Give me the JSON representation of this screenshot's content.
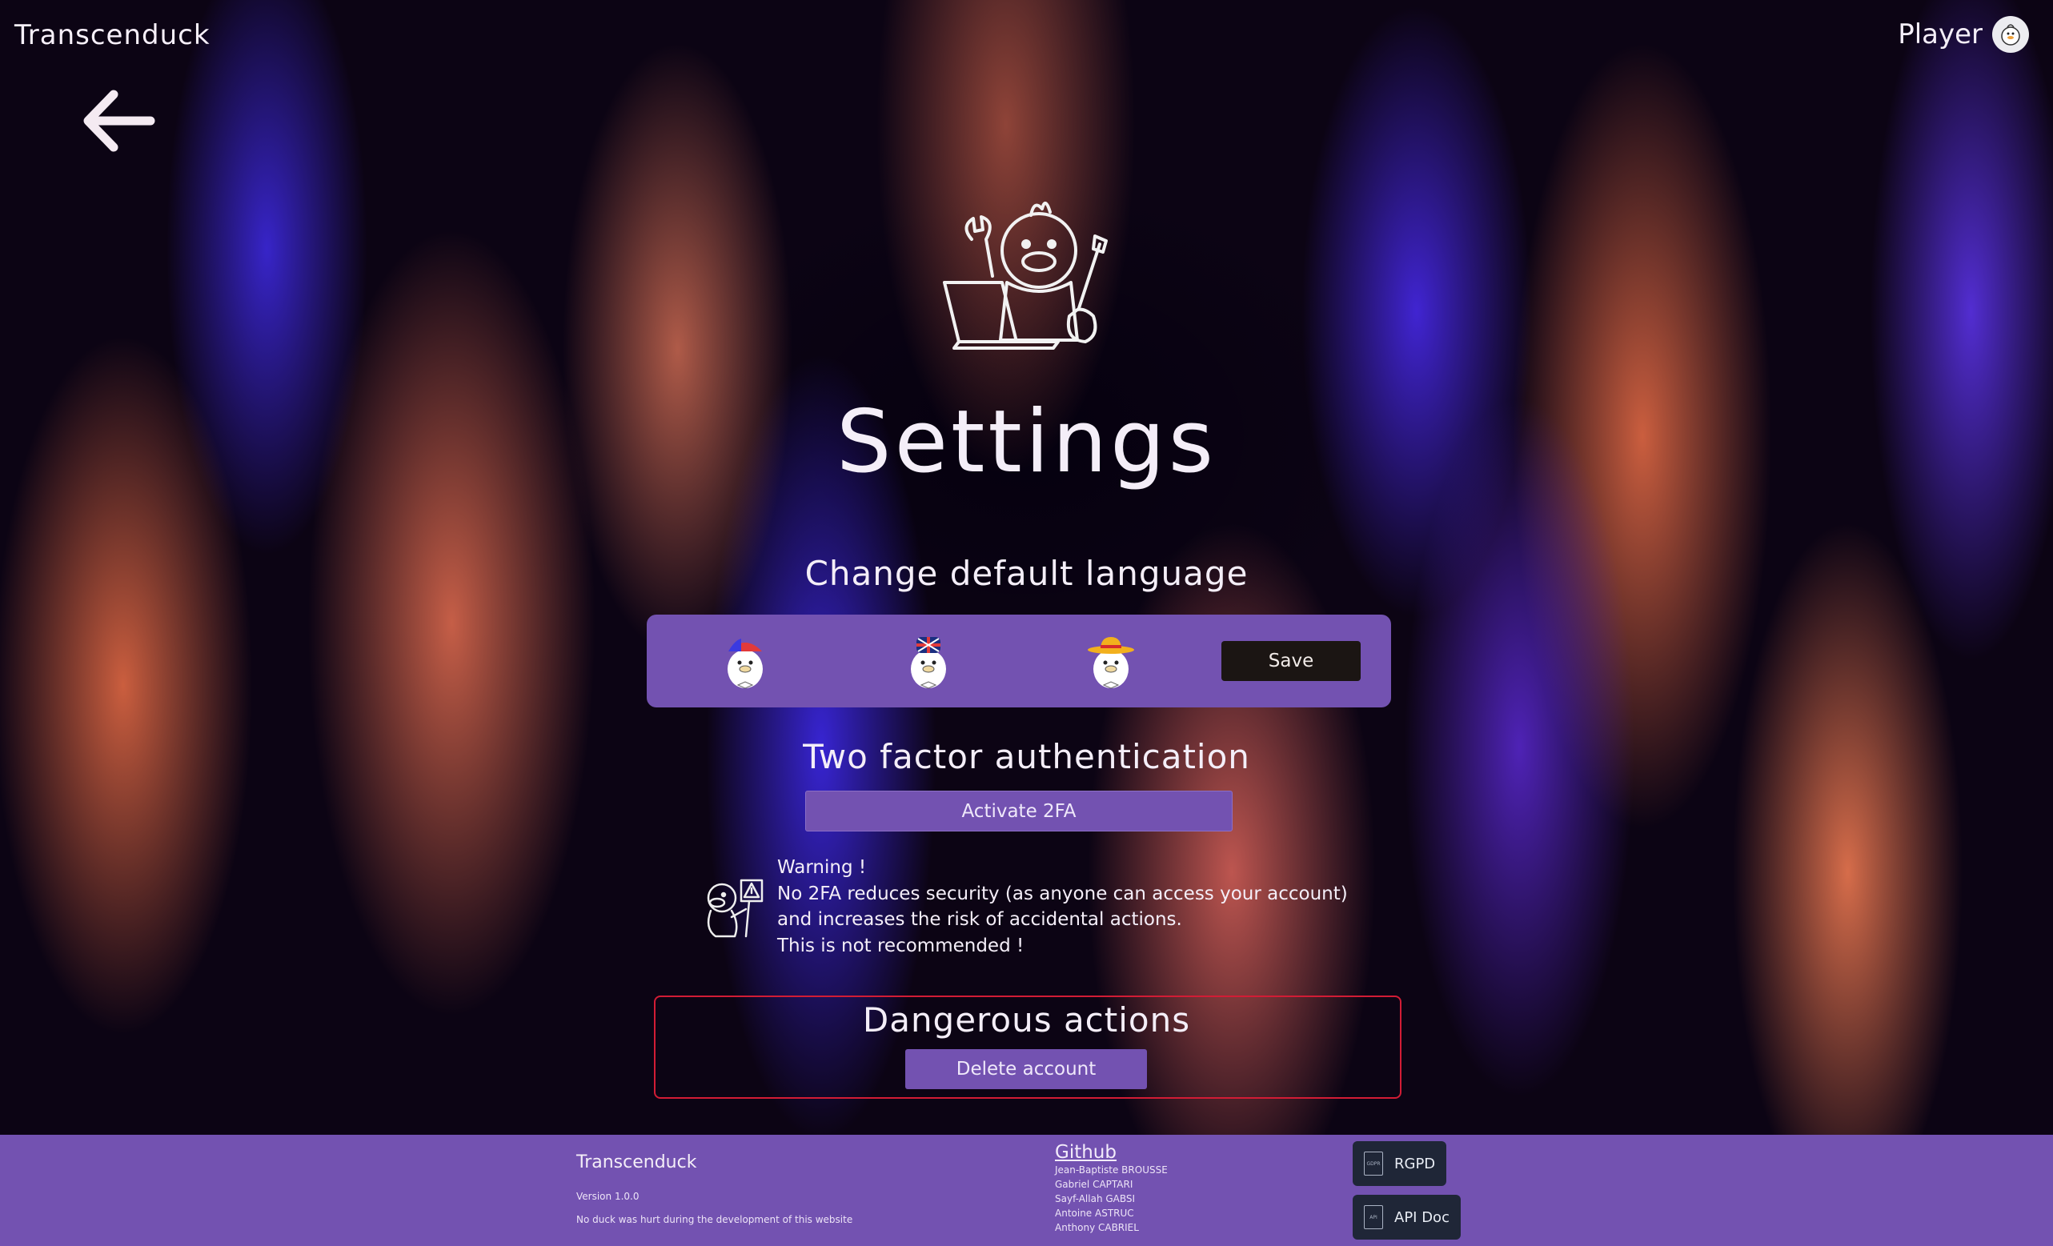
{
  "header": {
    "brand": "Transcenduck",
    "user_name": "Player",
    "back_icon": "arrow-left-icon",
    "avatar_icon": "duck-avatar-icon"
  },
  "page": {
    "title": "Settings",
    "hero_icon": "duck-repair-laptop-icon"
  },
  "language": {
    "heading": "Change default language",
    "options": [
      {
        "icon": "duck-french-flag-icon",
        "code": "fr"
      },
      {
        "icon": "duck-uk-flag-icon",
        "code": "en"
      },
      {
        "icon": "duck-spanish-flag-icon",
        "code": "es"
      }
    ],
    "save_label": "Save"
  },
  "twofa": {
    "heading": "Two factor authentication",
    "button_label": "Activate 2FA",
    "warning_lines": [
      "Warning !",
      "No 2FA reduces security (as anyone can access your account)",
      "and increases the risk of accidental actions.",
      "This is not recommended !"
    ]
  },
  "danger": {
    "heading": "Dangerous actions",
    "delete_label": "Delete account"
  },
  "footer": {
    "brand": "Transcenduck",
    "version": "Version 1.0.0",
    "tagline": "No duck was hurt during the development of this website",
    "github_label": "Github",
    "contributors": [
      "Jean-Baptiste BROUSSE",
      "Gabriel CAPTARI",
      "Sayf-Allah GABSI",
      "Antoine ASTRUC",
      "Anthony CABRIEL"
    ],
    "buttons": [
      {
        "label": "RGPD",
        "icon": "document-icon",
        "icon_text": "GDPR"
      },
      {
        "label": "API Doc",
        "icon": "document-icon",
        "icon_text": "API"
      }
    ]
  },
  "colors": {
    "panel": "#7352b1",
    "danger_border": "#d21c35",
    "save_button": "#1b1513",
    "footer_button": "#1f2637"
  }
}
